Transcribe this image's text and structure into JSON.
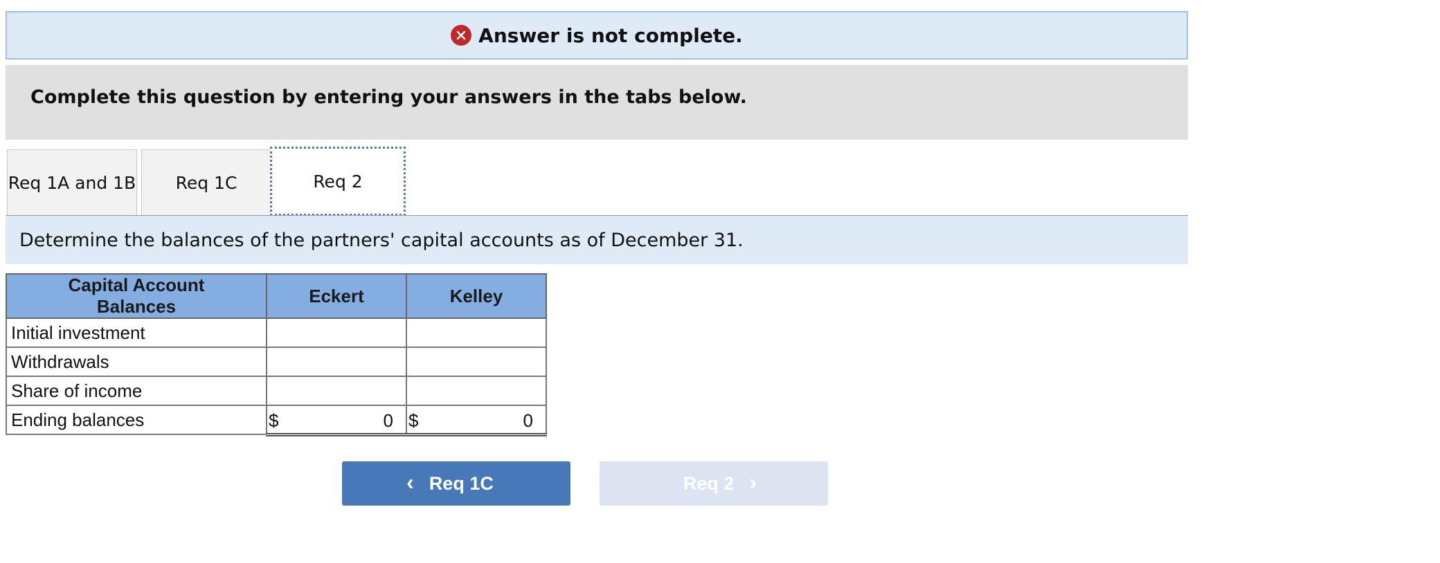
{
  "status_banner": {
    "message": "Answer is not complete.",
    "icon": "error-x-icon",
    "icon_color": "#c0282a"
  },
  "instruction": "Complete this question by entering your answers in the tabs below.",
  "tabs": [
    {
      "label": "Req 1A and 1B",
      "active": false
    },
    {
      "label": "Req 1C",
      "active": false
    },
    {
      "label": "Req 2",
      "active": true
    }
  ],
  "question": "Determine the balances of the partners' capital accounts as of December 31.",
  "table": {
    "headers": [
      "Capital Account Balances",
      "Eckert",
      "Kelley"
    ],
    "rows": [
      {
        "label": "Initial investment",
        "eckert": "",
        "kelley": ""
      },
      {
        "label": "Withdrawals",
        "eckert": "",
        "kelley": ""
      },
      {
        "label": "Share of income",
        "eckert": "",
        "kelley": ""
      },
      {
        "label": "Ending balances",
        "eckert_symbol": "$",
        "eckert": "0",
        "kelley_symbol": "$",
        "kelley": "0"
      }
    ]
  },
  "nav": {
    "prev_label": "Req 1C",
    "next_label": "Req 2",
    "next_disabled": true
  },
  "colors": {
    "banner_bg": "#dfeaf7",
    "header_bg": "#84aee2",
    "prev_button": "#4779b8",
    "next_button_disabled": "#dbe4f0"
  }
}
